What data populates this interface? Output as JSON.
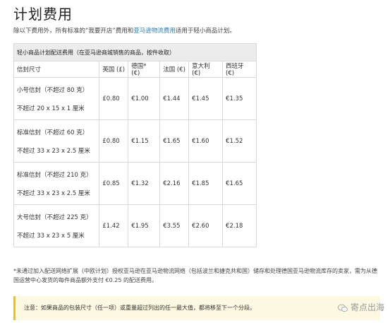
{
  "title": "计划费用",
  "intro": {
    "before": "除以下费用外，所有标准的“我要开店”费用和",
    "link": "亚马逊物流费用",
    "after": "适用于轻小商品计划。"
  },
  "table": {
    "caption": "轻小商品计划配送费用（在亚马逊商城销售的商品，按件收取）",
    "headers": [
      "信封尺寸",
      "英国 (£)",
      "德国* (€)",
      "法国 (€)",
      "意大利 (€)",
      "西班牙 (€)"
    ],
    "rows": [
      {
        "size": "小号信封（不超过 80 克）",
        "dims": "不超过 20 x 15 x 1 厘米",
        "values": [
          "£0.80",
          "€1.00",
          "€1.44",
          "€1.45",
          "€1.35"
        ]
      },
      {
        "size": "标准信封（不超过 60 克）",
        "dims": "不超过 33 x 23 x 2.5 厘米",
        "values": [
          "£0.80",
          "€1.15",
          "€1.65",
          "€1.60",
          "€1.52"
        ]
      },
      {
        "size": "标准信封（不超过 210 克）",
        "dims": "不超过 33 x 23 x 2.5 厘米",
        "values": [
          "£0.85",
          "€1.32",
          "€2.16",
          "€1.85",
          "€1.65"
        ]
      },
      {
        "size": "大号信封（不超过 225 克）",
        "dims": "不超过 33 x 23 x 5 厘米",
        "values": [
          "£1.42",
          "€1.95",
          "€3.55",
          "€2.60",
          "€2.18"
        ]
      }
    ]
  },
  "footnote": "*未通过加入配送网络扩展（中欧计划）授权亚马逊在亚马逊物流网络（包括波兰和捷克共和国）储存和处理德国亚马逊物流库存的卖家，需为从德国运营中心发货的每件商品额外支付 €0.25 的配送费用。",
  "note": "注意：如果商品的包装尺寸（任一项）或重量超过列出的任一最大值，都将移至下一个分段。",
  "watermark": "寄点出海"
}
